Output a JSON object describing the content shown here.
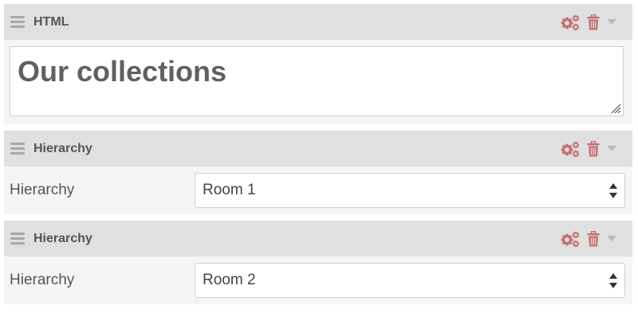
{
  "colors": {
    "header_bg": "#e0e0e0",
    "panel_bg": "#f5f5f5",
    "action_icon": "#c27070",
    "caret": "#bbbbbb"
  },
  "blocks": [
    {
      "title": "HTML",
      "type": "html",
      "content": "Our collections",
      "icons": [
        "drag-handle-icon",
        "settings-gears-icon",
        "trash-icon",
        "caret-down-icon",
        "resize-grip-icon"
      ]
    },
    {
      "title": "Hierarchy",
      "type": "select",
      "field_label": "Hierarchy",
      "selected": "Room 1",
      "icons": [
        "drag-handle-icon",
        "settings-gears-icon",
        "trash-icon",
        "caret-down-icon",
        "select-arrows-icon"
      ]
    },
    {
      "title": "Hierarchy",
      "type": "select",
      "field_label": "Hierarchy",
      "selected": "Room 2",
      "icons": [
        "drag-handle-icon",
        "settings-gears-icon",
        "trash-icon",
        "caret-down-icon",
        "select-arrows-icon"
      ]
    }
  ]
}
